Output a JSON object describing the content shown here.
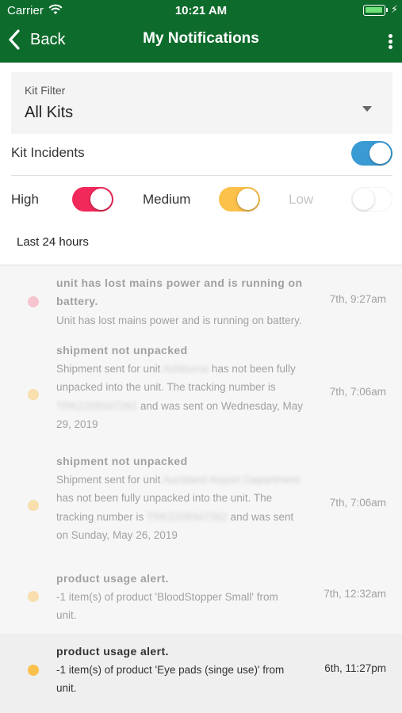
{
  "status_bar": {
    "carrier": "Carrier",
    "time": "10:21 AM"
  },
  "nav": {
    "back_label": "Back",
    "title": "My Notifications"
  },
  "kit_filter": {
    "label": "Kit Filter",
    "value": "All Kits"
  },
  "kit_incidents": {
    "label": "Kit Incidents",
    "enabled": true
  },
  "severity": {
    "high": {
      "label": "High",
      "enabled": true
    },
    "medium": {
      "label": "Medium",
      "enabled": true
    },
    "low": {
      "label": "Low",
      "enabled": false
    }
  },
  "time_range": "Last 24 hours",
  "notifications": [
    {
      "title": "unit has lost mains power and is running on",
      "title_2": "battery.",
      "body": "Unit has lost mains power and is running on battery.",
      "time": "7th, 9:27am",
      "severity": "high"
    },
    {
      "title": "shipment not unpacked",
      "body_1a": "Shipment sent for unit",
      "redacted_1": "Ashburne",
      "body_1b": "has not been fully",
      "body_2": "unpacked into the unit. The tracking number is",
      "redacted_2": "TRK2209347262",
      "body_3": "and was sent on Wednesday, May",
      "body_4": "29, 2019",
      "time": "7th, 7:06am",
      "severity": "medium"
    },
    {
      "title": "shipment not unpacked",
      "body_1a": "Shipment sent for unit",
      "redacted_1": "Auckland Airport Department",
      "body_2": "has not been fully unpacked into the unit. The",
      "body_3a": "tracking number is",
      "redacted_2": "TRK2209347262",
      "body_3b": "and was sent",
      "body_4": "on Sunday, May 26, 2019",
      "time": "7th, 7:06am",
      "severity": "medium"
    },
    {
      "title": "product usage alert.",
      "body_1": "-1 item(s) of product 'BloodStopper Small' from",
      "body_2": "unit.",
      "time": "7th, 12:32am",
      "severity": "medium"
    },
    {
      "title": "product usage alert.",
      "body_1": "-1 item(s) of product 'Eye pads (singe use)' from",
      "body_2": "unit.",
      "time": "6th, 11:27pm",
      "severity": "medium"
    }
  ],
  "colors": {
    "header": "#0d6b2c",
    "toggle_blue": "#3a9bd4",
    "toggle_red": "#f0295a",
    "toggle_yellow": "#fbc14b",
    "dot_high": "#f4809a",
    "dot_medium": "#fbc14b"
  },
  "icons": {
    "wifi": "wifi-icon",
    "battery": "battery-icon",
    "back": "chevron-left-icon",
    "more": "more-vertical-icon",
    "dropdown": "caret-down-icon"
  }
}
